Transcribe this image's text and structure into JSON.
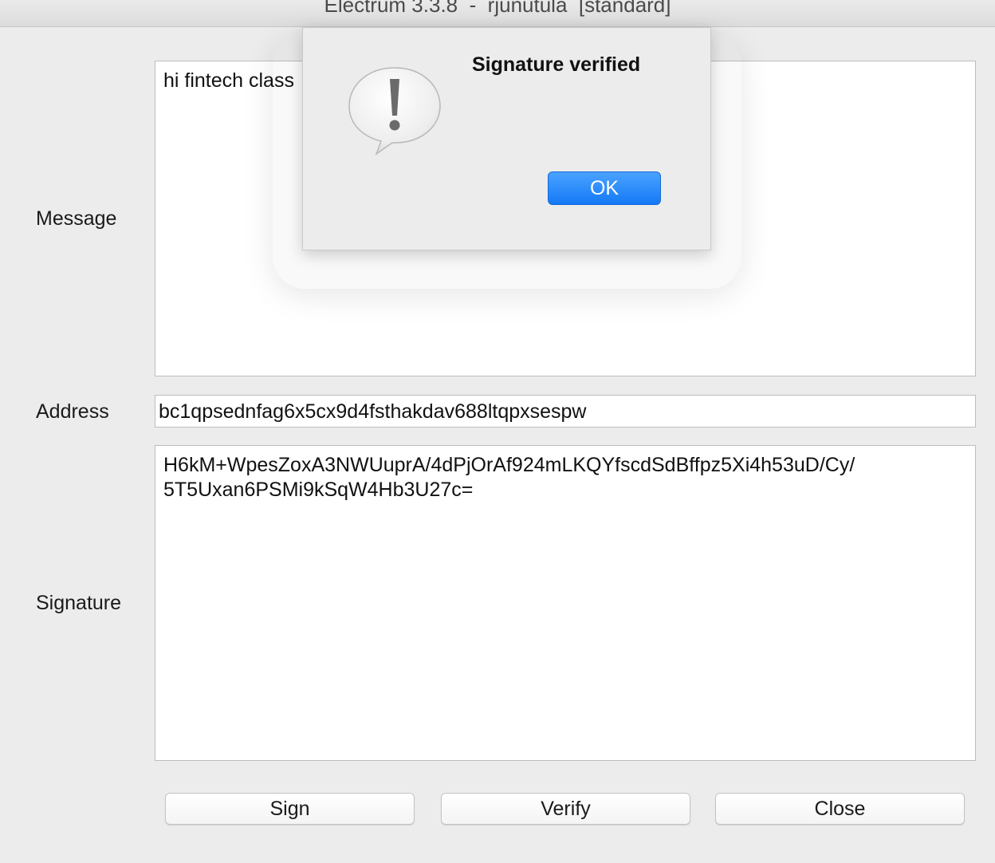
{
  "window": {
    "title": "Electrum 3.3.8  -  rjunutula  [standard]"
  },
  "form": {
    "message_label": "Message",
    "message_value": "hi fintech class",
    "address_label": "Address",
    "address_value": "bc1qpsednfag6x5cx9d4fsthakdav688ltqpxsespw",
    "signature_label": "Signature",
    "signature_value": "H6kM+WpesZoxA3NWUuprA/4dPjOrAf924mLKQYfscdSdBffpz5Xi4h53uD/Cy/\n5T5Uxan6PSMi9kSqW4Hb3U27c="
  },
  "buttons": {
    "sign_label": "Sign",
    "verify_label": "Verify",
    "close_label": "Close"
  },
  "dialog": {
    "title": "Signature verified",
    "ok_label": "OK",
    "icon": "exclamation-alert-icon",
    "accent_color": "#1479f5"
  }
}
